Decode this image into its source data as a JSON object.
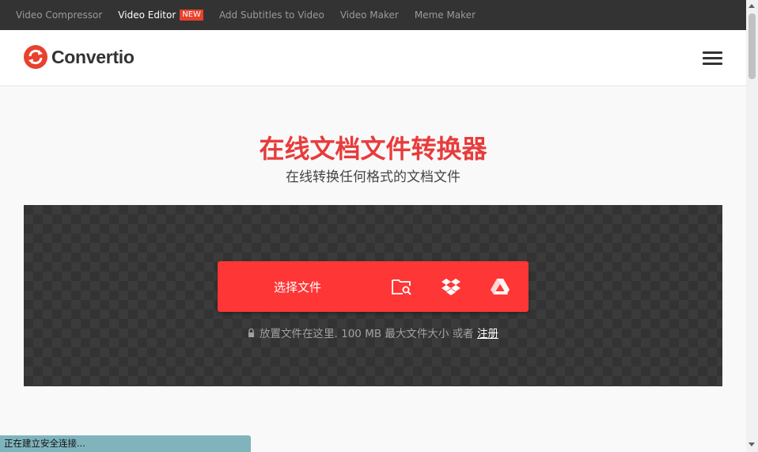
{
  "topnav": {
    "items": [
      {
        "label": "Video Compressor"
      },
      {
        "label": "Video Editor",
        "badge": "NEW"
      },
      {
        "label": "Add Subtitles to Video"
      },
      {
        "label": "Video Maker"
      },
      {
        "label": "Meme Maker"
      }
    ]
  },
  "header": {
    "logo_text": "Convertio",
    "menu_icon": "hamburger-menu-icon"
  },
  "hero": {
    "title": "在线文档文件转换器",
    "subtitle": "在线转换任何格式的文档文件"
  },
  "upload": {
    "choose_label": "选择文件",
    "sources": [
      "folder-search-icon",
      "dropbox-icon",
      "google-drive-icon"
    ],
    "drop_hint": "放置文件在这里. 100 MB 最大文件大小 或者",
    "signup_link": "注册"
  },
  "statusbar": {
    "text": "正在建立安全连接..."
  },
  "colors": {
    "accent": "#ff3636",
    "title": "#e93b3b",
    "topbar": "#333333"
  }
}
